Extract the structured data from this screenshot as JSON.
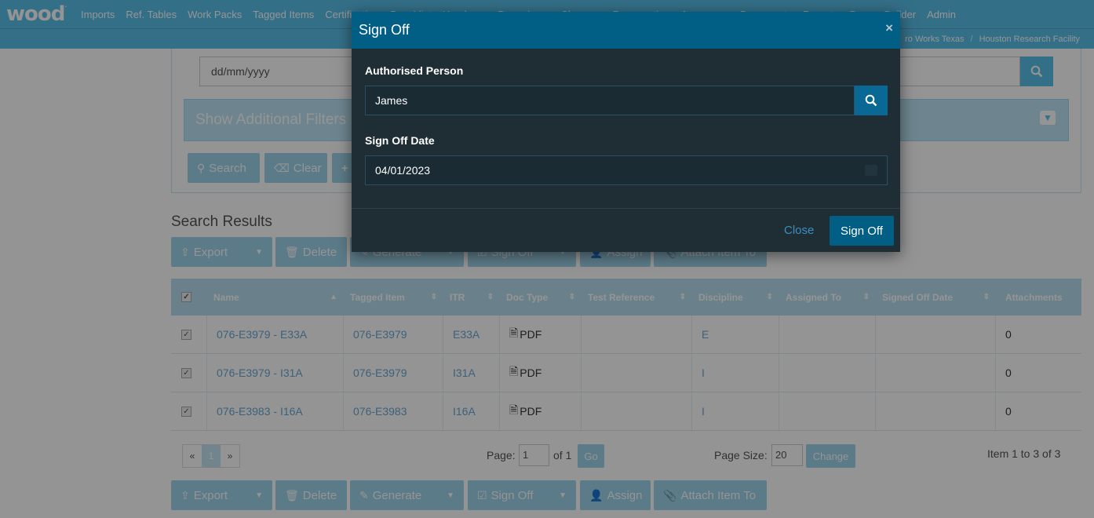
{
  "brand": {
    "logo": "wood",
    "logo_mark": "."
  },
  "nav": {
    "items": [
      "Imports",
      "Ref. Tables",
      "Work Packs",
      "Tagged Items",
      "Certification",
      "Punchlist",
      "Handover",
      "Procedures",
      "Changes",
      "Preservation",
      "Assurance",
      "Documents",
      "Reports",
      "Proc.",
      "Builder",
      "Admin"
    ]
  },
  "breadcrumb": {
    "items": [
      "ro Works Texas",
      "Houston Research Facility"
    ]
  },
  "filters": {
    "date_placeholder": "dd/mm/yyyy",
    "additional_filters_label": "Show Additional Filters",
    "search_button": "Search",
    "clear_button": "Clear",
    "add_button": "+"
  },
  "results": {
    "title": "Search Results",
    "toolbar": {
      "export": "Export",
      "delete": "Delete",
      "generate": "Generate",
      "signoff": "Sign Off",
      "assign": "Assign",
      "attach": "Attach Item To"
    },
    "columns": [
      "Name",
      "Tagged Item",
      "ITR",
      "Doc Type",
      "Test Reference",
      "Discipline",
      "Assigned To",
      "Signed Off Date",
      "Attachments"
    ],
    "rows": [
      {
        "name": "076-E3979 - E33A",
        "tagged_item": "076-E3979",
        "itr": "E33A",
        "doc_type": "PDF",
        "test_reference": "",
        "discipline": "E",
        "assigned_to": "",
        "signed_off_date": "",
        "attachments": "0"
      },
      {
        "name": "076-E3979 - I31A",
        "tagged_item": "076-E3979",
        "itr": "I31A",
        "doc_type": "PDF",
        "test_reference": "",
        "discipline": "I",
        "assigned_to": "",
        "signed_off_date": "",
        "attachments": "0"
      },
      {
        "name": "076-E3983 - I16A",
        "tagged_item": "076-E3983",
        "itr": "I16A",
        "doc_type": "PDF",
        "test_reference": "",
        "discipline": "I",
        "assigned_to": "",
        "signed_off_date": "",
        "attachments": "0"
      }
    ],
    "pagination": {
      "prev": "«",
      "current": "1",
      "next": "»",
      "page_label": "Page:",
      "page_value": "1",
      "of_label": "of 1",
      "go": "Go",
      "page_size_label": "Page Size:",
      "page_size_value": "20",
      "change": "Change",
      "summary": "Item 1 to 3 of 3"
    }
  },
  "modal": {
    "title": "Sign Off",
    "close_icon": "×",
    "authorised_person_label": "Authorised Person",
    "authorised_person_value": "James",
    "signoff_date_label": "Sign Off Date",
    "signoff_date_value": "04/01/2023",
    "close_button": "Close",
    "signoff_button": "Sign Off"
  }
}
